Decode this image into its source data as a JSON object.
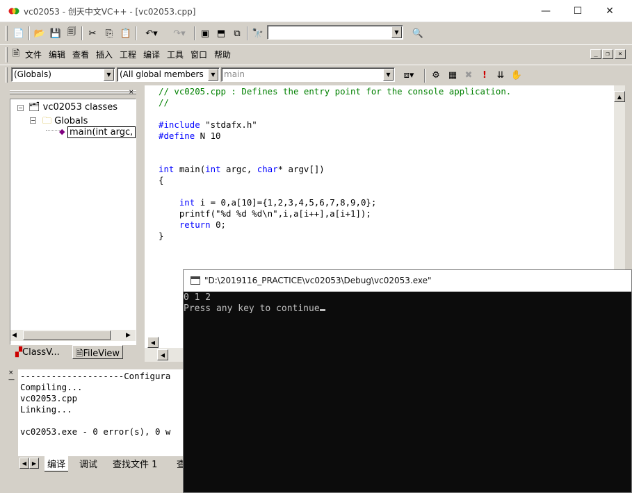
{
  "window": {
    "title": "vc02053 - 创天中文VC++ - [vc02053.cpp]"
  },
  "caption_buttons": {
    "minimize": "—",
    "maximize": "☐",
    "close": "✕"
  },
  "menu": {
    "items": [
      "文件",
      "编辑",
      "查看",
      "插入",
      "工程",
      "编译",
      "工具",
      "窗口",
      "帮助"
    ]
  },
  "mdi_buttons": {
    "minimize": "_",
    "restore": "❐",
    "close": "×"
  },
  "toolbar": {
    "find_combo_value": ""
  },
  "wizardbar": {
    "class_combo": "(Globals)",
    "filter_combo": "(All global members",
    "member_combo": "main"
  },
  "workspace": {
    "tree": {
      "root": "vc02053 classes",
      "folder": "Globals",
      "leaf": "main(int argc,"
    },
    "tabs": [
      "ClassV...",
      "FileView"
    ]
  },
  "editor": {
    "lines": [
      [
        {
          "t": "// vc0205.cpp : Defines the entry point for the console application.",
          "c": "cm"
        }
      ],
      [
        {
          "t": "//",
          "c": "cm"
        }
      ],
      [
        {
          "t": ""
        }
      ],
      [
        {
          "t": "#include",
          "c": "kw"
        },
        {
          "t": " \"stdafx.h\""
        }
      ],
      [
        {
          "t": "#define",
          "c": "kw"
        },
        {
          "t": " N 10"
        }
      ],
      [
        {
          "t": ""
        }
      ],
      [
        {
          "t": ""
        }
      ],
      [
        {
          "t": "int",
          "c": "kw"
        },
        {
          "t": " main("
        },
        {
          "t": "int",
          "c": "kw"
        },
        {
          "t": " argc, "
        },
        {
          "t": "char",
          "c": "kw"
        },
        {
          "t": "* argv[])"
        }
      ],
      [
        {
          "t": "{"
        }
      ],
      [
        {
          "t": ""
        }
      ],
      [
        {
          "t": "    "
        },
        {
          "t": "int",
          "c": "kw"
        },
        {
          "t": " i = 0,a[10]={1,2,3,4,5,6,7,8,9,0};"
        }
      ],
      [
        {
          "t": "    printf(\"%d %d %d\\n\",i,a[i++],a[i+1]);"
        }
      ],
      [
        {
          "t": "    "
        },
        {
          "t": "return",
          "c": "kw"
        },
        {
          "t": " 0;"
        }
      ],
      [
        {
          "t": "}"
        }
      ]
    ]
  },
  "output": {
    "lines": [
      "--------------------Configura",
      "Compiling...",
      "vc02053.cpp",
      "Linking...",
      "",
      "vc02053.exe - 0 error(s), 0 w"
    ],
    "tabs": [
      "编译",
      "调试",
      "查找文件 1",
      "查"
    ]
  },
  "console": {
    "title": "\"D:\\2019116_PRACTICE\\vc02053\\Debug\\vc02053.exe\"",
    "lines": [
      "0 1 2",
      "Press any key to continue"
    ]
  }
}
